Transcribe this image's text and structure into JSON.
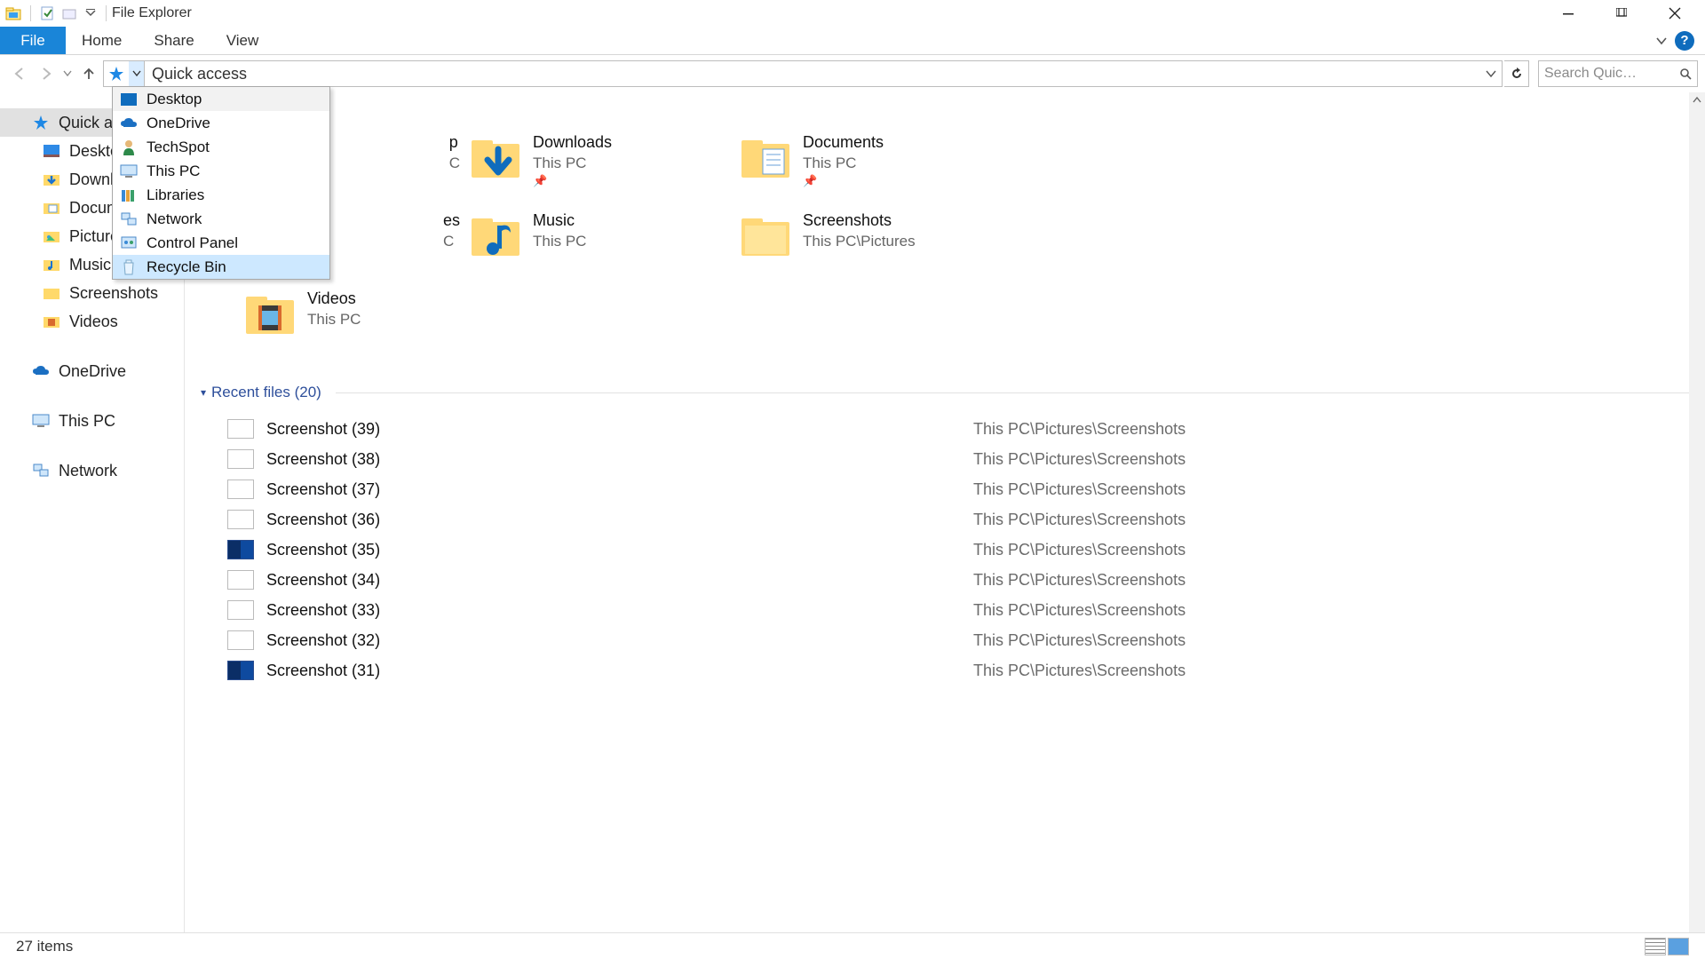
{
  "window": {
    "title": "File Explorer"
  },
  "ribbon": {
    "file": "File",
    "tabs": [
      "Home",
      "Share",
      "View"
    ]
  },
  "addressbar": {
    "text": "Quick access"
  },
  "search": {
    "placeholder": "Search Quic…"
  },
  "dropdown": {
    "items": [
      {
        "label": "Desktop",
        "icon": "desktop",
        "state": "hover-light"
      },
      {
        "label": "OneDrive",
        "icon": "onedrive",
        "state": ""
      },
      {
        "label": "TechSpot",
        "icon": "user",
        "state": ""
      },
      {
        "label": "This PC",
        "icon": "thispc",
        "state": ""
      },
      {
        "label": "Libraries",
        "icon": "libraries",
        "state": ""
      },
      {
        "label": "Network",
        "icon": "network",
        "state": ""
      },
      {
        "label": "Control Panel",
        "icon": "controlpanel",
        "state": ""
      },
      {
        "label": "Recycle Bin",
        "icon": "recyclebin",
        "state": "hover"
      }
    ]
  },
  "sidebar": {
    "quick_access": {
      "label": "Quick acc",
      "selected": true
    },
    "children": [
      {
        "label": "Desktop",
        "icon": "desktop-small"
      },
      {
        "label": "Downloa",
        "icon": "downloads"
      },
      {
        "label": "Docume",
        "icon": "documents"
      },
      {
        "label": "Pictures",
        "icon": "pictures"
      },
      {
        "label": "Music",
        "icon": "music"
      },
      {
        "label": "Screenshots",
        "icon": "folder"
      },
      {
        "label": "Videos",
        "icon": "videos"
      }
    ],
    "onedrive": {
      "label": "OneDrive"
    },
    "thispc": {
      "label": "This PC"
    },
    "network": {
      "label": "Network"
    }
  },
  "frequent": {
    "tiles": [
      {
        "name": "p",
        "sub": "C",
        "icon": "desktop",
        "col": 0,
        "visible_partial": true
      },
      {
        "name": "Downloads",
        "sub": "This PC",
        "icon": "downloads",
        "pin": true
      },
      {
        "name": "Documents",
        "sub": "This PC",
        "icon": "documents",
        "pin": true
      },
      {
        "name": "es",
        "sub": "C",
        "icon": "folder",
        "col": 0,
        "visible_partial": true
      },
      {
        "name": "Music",
        "sub": "This PC",
        "icon": "music"
      },
      {
        "name": "Screenshots",
        "sub": "This PC\\Pictures",
        "icon": "folder"
      },
      {
        "name": "Videos",
        "sub": "This PC",
        "icon": "videos",
        "col": 0
      }
    ]
  },
  "recent": {
    "header": "Recent files (20)",
    "rows": [
      {
        "name": "Screenshot (39)",
        "path": "This PC\\Pictures\\Screenshots",
        "thumb": "light"
      },
      {
        "name": "Screenshot (38)",
        "path": "This PC\\Pictures\\Screenshots",
        "thumb": "light"
      },
      {
        "name": "Screenshot (37)",
        "path": "This PC\\Pictures\\Screenshots",
        "thumb": "light"
      },
      {
        "name": "Screenshot (36)",
        "path": "This PC\\Pictures\\Screenshots",
        "thumb": "light"
      },
      {
        "name": "Screenshot (35)",
        "path": "This PC\\Pictures\\Screenshots",
        "thumb": "dark"
      },
      {
        "name": "Screenshot (34)",
        "path": "This PC\\Pictures\\Screenshots",
        "thumb": "light"
      },
      {
        "name": "Screenshot (33)",
        "path": "This PC\\Pictures\\Screenshots",
        "thumb": "light"
      },
      {
        "name": "Screenshot (32)",
        "path": "This PC\\Pictures\\Screenshots",
        "thumb": "light"
      },
      {
        "name": "Screenshot (31)",
        "path": "This PC\\Pictures\\Screenshots",
        "thumb": "dark"
      }
    ]
  },
  "status": {
    "text": "27 items"
  }
}
